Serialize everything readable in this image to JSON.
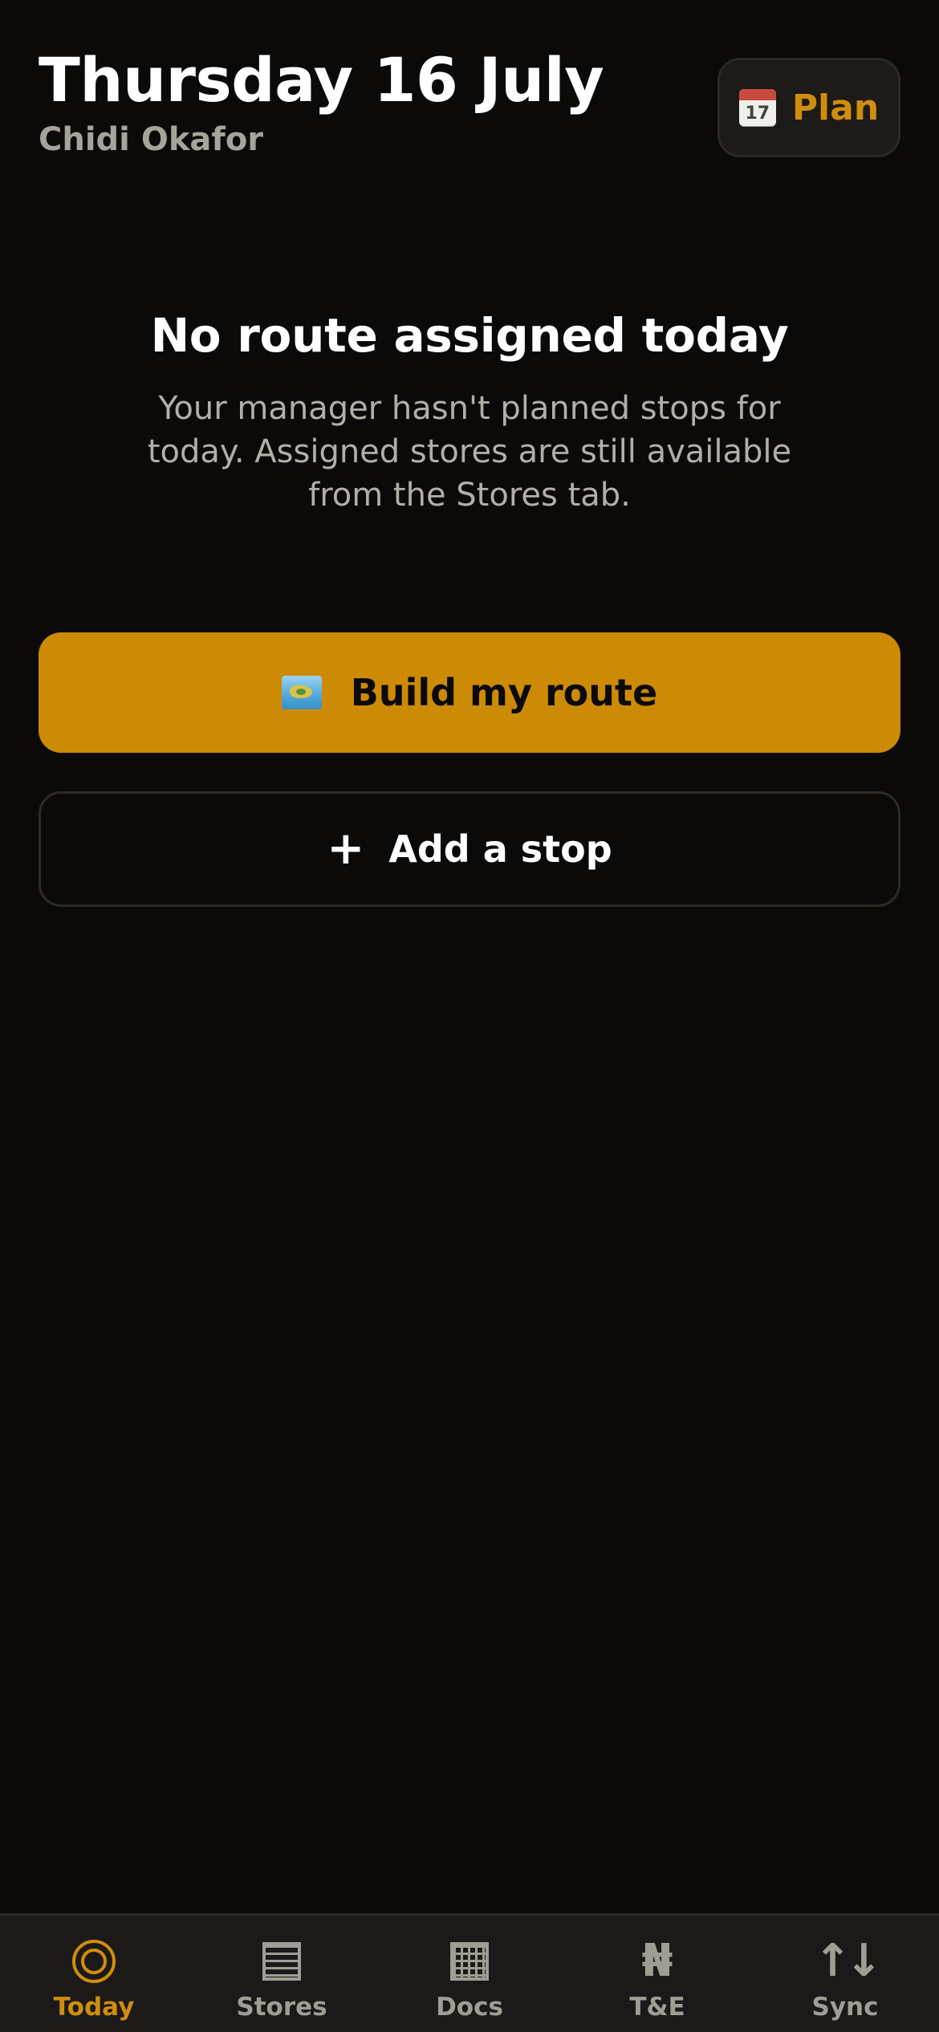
{
  "header": {
    "title": "Thursday 16 July",
    "user_name": "Chidi Okafor",
    "plan_button": {
      "label": "Plan",
      "icon": "calendar-icon",
      "calendar_day": "17"
    }
  },
  "empty_state": {
    "heading": "No route assigned today",
    "message": "Your manager hasn't planned stops for today. Assigned stores are still available from the Stores tab."
  },
  "actions": {
    "build_route": {
      "label": "Build my route",
      "icon": "map-icon"
    },
    "add_stop": {
      "label": "Add a stop",
      "icon": "plus-icon",
      "icon_glyph": "+"
    }
  },
  "tabbar": {
    "active": "today",
    "tabs": [
      {
        "id": "today",
        "label": "Today",
        "icon": "target-icon"
      },
      {
        "id": "stores",
        "label": "Stores",
        "icon": "list-icon"
      },
      {
        "id": "docs",
        "label": "Docs",
        "icon": "grid-icon"
      },
      {
        "id": "te",
        "label": "T&E",
        "icon": "naira-icon",
        "glyph": "₦"
      },
      {
        "id": "sync",
        "label": "Sync",
        "icon": "sync-icon",
        "glyph": "↑↓"
      }
    ]
  },
  "colors": {
    "background": "#0b0a09",
    "accent": "#cd8a04",
    "muted_text": "#a7a29a",
    "tabbar_bg": "#1c1a18"
  }
}
